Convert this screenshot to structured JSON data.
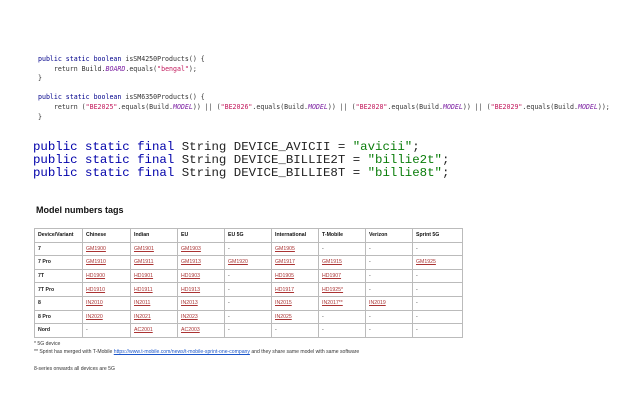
{
  "code_top": {
    "line1": {
      "kw": "public static boolean",
      "name": " isSM4250Products() {"
    },
    "line2": {
      "pre": "    return Build.",
      "field": "BOARD",
      "mid": ".equals(",
      "str": "\"bengal\"",
      "end": ");"
    },
    "line3": "}",
    "line4": {
      "kw": "public static boolean",
      "name": " isSM6350Products() {"
    },
    "line5": {
      "pre": "    return (",
      "s1": "\"BE2025\"",
      "m1": ".equals(Build.",
      "f1": "MODEL",
      "c1": ")) || (",
      "s2": "\"BE2026\"",
      "m2": ".equals(Build.",
      "f2": "MODEL",
      "c2": ")) || (",
      "s3": "\"BE2028\"",
      "m3": ".equals(Build.",
      "f3": "MODEL",
      "c3": ")) || (",
      "s4": "\"BE2029\"",
      "m4": ".equals(Build.",
      "f4": "MODEL",
      "c4": "));"
    },
    "line6": "}"
  },
  "code_bottom": [
    {
      "kw": "public static final",
      "rest": " String DEVICE_AVICII = ",
      "str": "\"avicii\"",
      "end": ";"
    },
    {
      "kw": "public static final",
      "rest": " String DEVICE_BILLIE2T = ",
      "str": "\"billie2t\"",
      "end": ";"
    },
    {
      "kw": "public static final",
      "rest": " String DEVICE_BILLIE8T = ",
      "str": "\"billie8t\"",
      "end": ";"
    }
  ],
  "heading": "Model numbers tags",
  "table": {
    "headers": [
      "Device/Variant",
      "Chinese",
      "Indian",
      "EU",
      "EU 5G",
      "International",
      "T-Mobile",
      "Verizon",
      "Sprint 5G"
    ],
    "rows": [
      [
        "7",
        "GM1900",
        "GM1901",
        "GM1903",
        "-",
        "GM1905",
        "-",
        "-",
        "-"
      ],
      [
        "7 Pro",
        "GM1910",
        "GM1911",
        "GM1913",
        "GM1920",
        "GM1917",
        "GM1915",
        "-",
        "GM1925"
      ],
      [
        "7T",
        "HD1900",
        "HD1901",
        "HD1903",
        "-",
        "HD1905",
        "HD1907",
        "-",
        "-"
      ],
      [
        "7T Pro",
        "HD1910",
        "HD1911",
        "HD1913",
        "-",
        "HD1917",
        "HD1925*",
        "-",
        "-"
      ],
      [
        "8",
        "IN2010",
        "IN2011",
        "IN2013",
        "-",
        "IN2015",
        "IN2017**",
        "IN2019",
        "-"
      ],
      [
        "8 Pro",
        "IN2020",
        "IN2021",
        "IN2023",
        "-",
        "IN2025",
        "-",
        "-",
        "-"
      ],
      [
        "Nord",
        "-",
        "AC2001",
        "AC2003",
        "-",
        "-",
        "-",
        "-",
        "-"
      ]
    ]
  },
  "notes": {
    "n1": "* 5G device",
    "n2_pre": "** Sprint has merged with T-Mobile ",
    "n2_link": "https://www.t-mobile.com/news/t-mobile-sprint-one-company",
    "n2_post": " and they share same model with same software",
    "n3": "8-series onwards all devices are 5G"
  }
}
